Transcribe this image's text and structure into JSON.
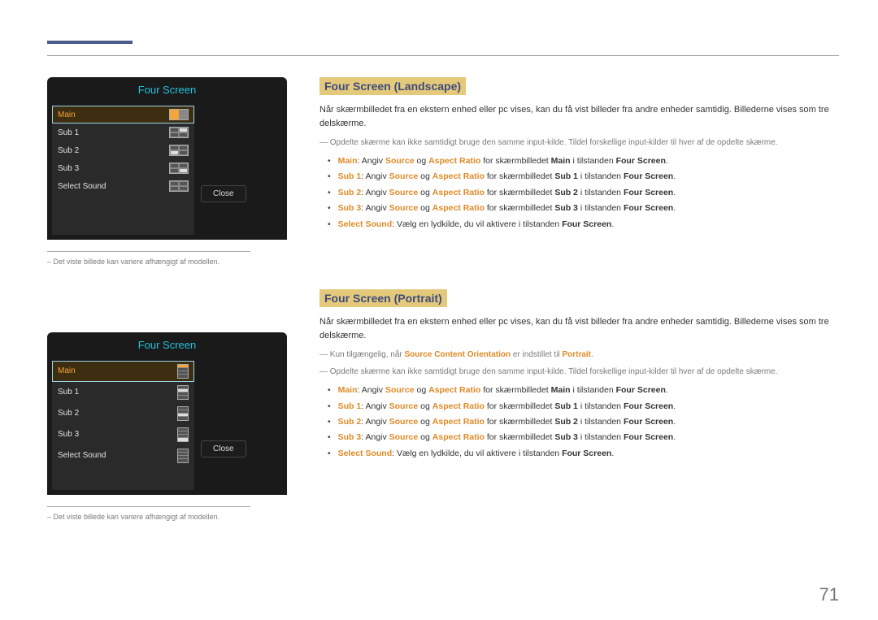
{
  "page_number": "71",
  "osd": {
    "title": "Four Screen",
    "items": [
      "Main",
      "Sub 1",
      "Sub 2",
      "Sub 3",
      "Select Sound"
    ],
    "close": "Close"
  },
  "note_model": "Det viste billede kan variere afhængigt af modellen.",
  "section1": {
    "heading": "Four Screen (Landscape)",
    "intro": "Når skærmbilledet fra en ekstern enhed eller pc vises, kan du få vist billeder fra andre enheder samtidig. Billederne vises som tre delskærme.",
    "dash1": "Opdelte skærme kan ikke samtidigt bruge den samme input-kilde. Tildel forskellige input-kilder til hver af de opdelte skærme.",
    "b_main_1": "Main",
    "b_main_2": ": Angiv ",
    "b_main_3": "Source",
    "b_main_4": " og ",
    "b_main_5": "Aspect Ratio",
    "b_main_6": " for skærmbilledet ",
    "b_main_7": "Main",
    "b_main_8": " i tilstanden ",
    "b_main_9": "Four Screen",
    "b_main_10": ".",
    "b_sub1_1": "Sub 1",
    "b_sub1_7": "Sub 1",
    "b_sub2_1": "Sub 2",
    "b_sub2_7": "Sub 2",
    "b_sub3_1": "Sub 3",
    "b_sub3_7": "Sub 3",
    "b_ss_1": "Select Sound",
    "b_ss_2": ": Vælg en lydkilde, du vil aktivere i tilstanden ",
    "b_ss_3": "Four Screen",
    "b_ss_4": "."
  },
  "section2": {
    "heading": "Four Screen (Portrait)",
    "intro": "Når skærmbilledet fra en ekstern enhed eller pc vises, kan du få vist billeder fra andre enheder samtidig. Billederne vises som tre delskærme.",
    "dash0_a": "Kun tilgængelig, når ",
    "dash0_b": "Source Content Orientation",
    "dash0_c": " er indstillet til ",
    "dash0_d": "Portrait",
    "dash0_e": ".",
    "dash1": "Opdelte skærme kan ikke samtidigt bruge den samme input-kilde. Tildel forskellige input-kilder til hver af de opdelte skærme."
  },
  "bullet_common": {
    "angiv": ": Angiv ",
    "source": "Source",
    "og": " og ",
    "aspect": "Aspect Ratio",
    "forsb": " for skærmbilledet ",
    "itil": " i tilstanden ",
    "fs": "Four Screen",
    "dot": "."
  }
}
